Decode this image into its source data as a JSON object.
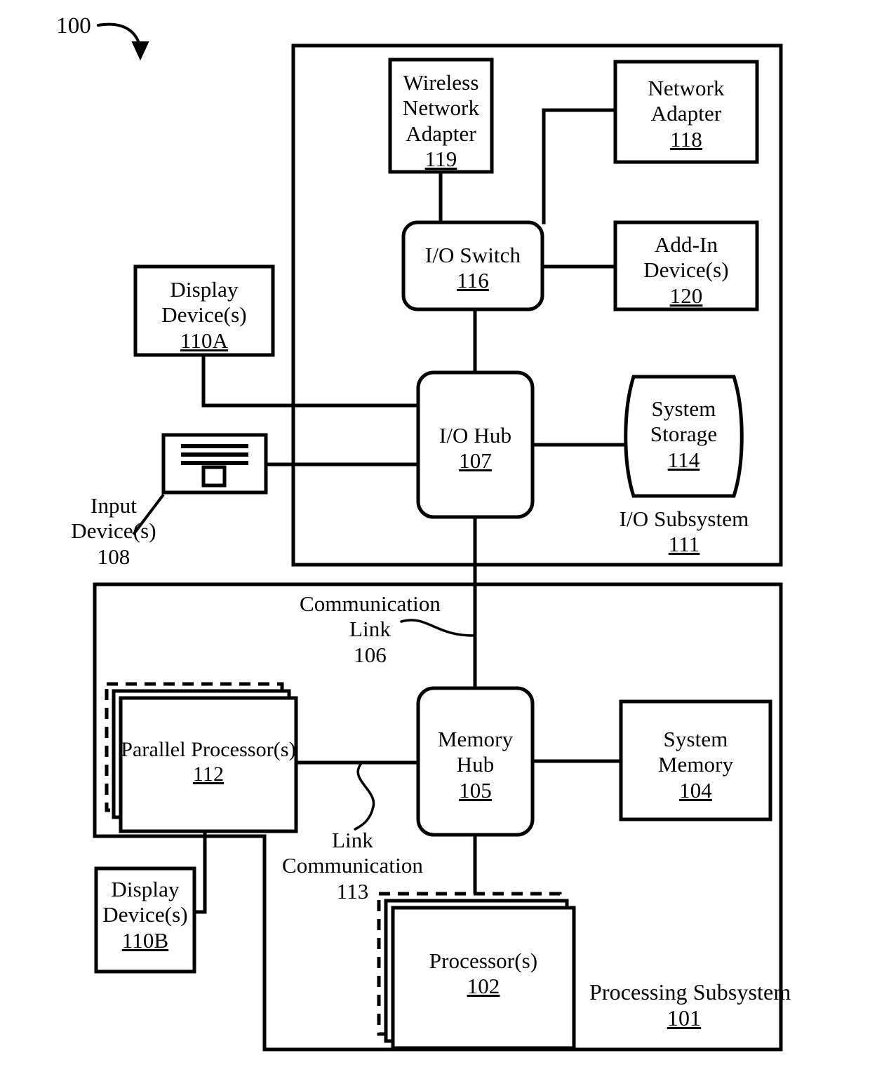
{
  "figure": {
    "ref_numeral": "100",
    "style": "patent-block-diagram",
    "line_color": "#000000",
    "background": "#ffffff"
  },
  "subsystems": [
    {
      "id": "io-subsystem",
      "name": "I/O Subsystem",
      "number": "111",
      "number_underlined": true
    },
    {
      "id": "processing-subsystem",
      "name": "Processing Subsystem",
      "number": "101",
      "number_underlined": true
    }
  ],
  "blocks": {
    "wireless_network_adapter": {
      "lines": [
        "Wireless",
        "Network",
        "Adapter"
      ],
      "number": "119",
      "shape": "rect"
    },
    "network_adapter": {
      "lines": [
        "Network",
        "Adapter"
      ],
      "number": "118",
      "shape": "rect"
    },
    "io_switch": {
      "lines": [
        "I/O Switch"
      ],
      "number": "116",
      "shape": "rounded-rect"
    },
    "add_in_device": {
      "lines": [
        "Add-In",
        "Device(s)"
      ],
      "number": "120",
      "shape": "rect"
    },
    "display_device_a": {
      "lines": [
        "Display",
        "Device(s)"
      ],
      "number": "110A",
      "shape": "rect"
    },
    "io_hub": {
      "lines": [
        "I/O Hub"
      ],
      "number": "107",
      "shape": "rounded-rect"
    },
    "system_storage": {
      "lines": [
        "System",
        "Storage"
      ],
      "number": "114",
      "shape": "cylinder"
    },
    "input_device": {
      "lines": [
        "Input",
        "Device(s)"
      ],
      "number": "108",
      "number_underlined": false,
      "shape": "keyboard-icon",
      "icon": "keyboard-icon"
    },
    "parallel_processors": {
      "lines": [
        "Parallel Processor(s)"
      ],
      "number": "112",
      "shape": "stacked-rect-dashed-back"
    },
    "memory_hub": {
      "lines": [
        "Memory",
        "Hub"
      ],
      "number": "105",
      "shape": "rounded-rect"
    },
    "system_memory": {
      "lines": [
        "System",
        "Memory"
      ],
      "number": "104",
      "shape": "rect"
    },
    "display_device_b": {
      "lines": [
        "Display",
        "Device(s)"
      ],
      "number": "110B",
      "shape": "rect"
    },
    "processors": {
      "lines": [
        "Processor(s)"
      ],
      "number": "102",
      "shape": "stacked-rect-dashed-back"
    }
  },
  "link_labels": {
    "communication_link_106": {
      "lines": [
        "Communication",
        "Link"
      ],
      "number": "106",
      "number_underlined": false
    },
    "link_communication_113": {
      "lines": [
        "Link",
        "Communication"
      ],
      "number": "113",
      "number_underlined": false
    }
  },
  "connections": [
    {
      "from": "wireless_network_adapter",
      "to": "io_switch"
    },
    {
      "from": "network_adapter",
      "to": "io_switch"
    },
    {
      "from": "io_switch",
      "to": "add_in_device"
    },
    {
      "from": "io_switch",
      "to": "io_hub"
    },
    {
      "from": "display_device_a",
      "to": "io_hub"
    },
    {
      "from": "input_device",
      "to": "io_hub"
    },
    {
      "from": "io_hub",
      "to": "system_storage"
    },
    {
      "from": "io_hub",
      "to": "memory_hub",
      "label": "communication_link_106"
    },
    {
      "from": "parallel_processors",
      "to": "memory_hub",
      "label": "link_communication_113"
    },
    {
      "from": "memory_hub",
      "to": "system_memory"
    },
    {
      "from": "memory_hub",
      "to": "processors"
    },
    {
      "from": "parallel_processors",
      "to": "display_device_b"
    }
  ]
}
